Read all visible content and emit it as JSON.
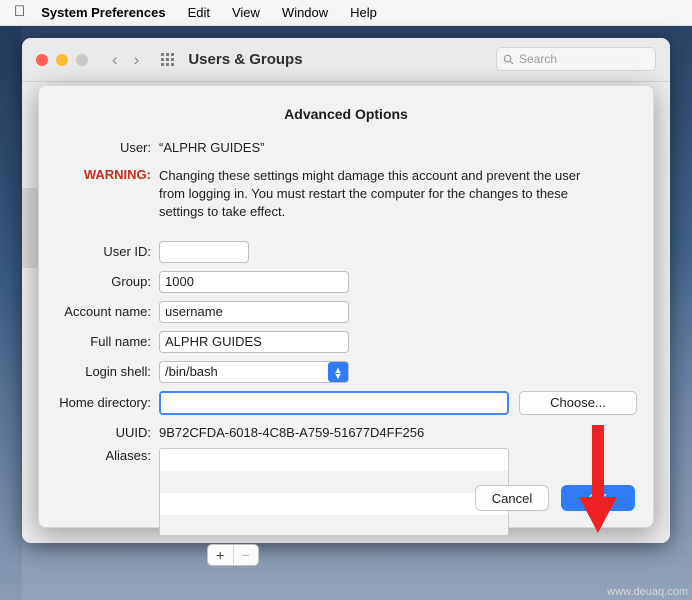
{
  "menubar": {
    "apple_icon": "apple-icon",
    "items": [
      {
        "label": "System Preferences",
        "bold": true
      },
      {
        "label": "Edit",
        "bold": false
      },
      {
        "label": "View",
        "bold": false
      },
      {
        "label": "Window",
        "bold": false
      },
      {
        "label": "Help",
        "bold": false
      }
    ]
  },
  "prefs_window": {
    "title": "Users & Groups",
    "search_placeholder": "Search",
    "back_icon": "chevron-left-icon",
    "forward_icon": "chevron-right-icon",
    "grid_icon": "grid-icon",
    "search_icon": "search-icon"
  },
  "sheet": {
    "title": "Advanced Options",
    "user_label": "User:",
    "user_value": "“ALPHR GUIDES”",
    "warning_label": "WARNING:",
    "warning_text": "Changing these settings might damage this account and prevent the user from logging in. You must restart the computer for the changes to these settings to take effect.",
    "fields": {
      "user_id": {
        "label": "User ID:",
        "value": ""
      },
      "group": {
        "label": "Group:",
        "value": "1000"
      },
      "account_name": {
        "label": "Account name:",
        "value": "username"
      },
      "full_name": {
        "label": "Full name:",
        "value": "ALPHR GUIDES"
      },
      "login_shell": {
        "label": "Login shell:",
        "value": "/bin/bash",
        "dropdown_icon": "chevron-updown-icon"
      },
      "home_directory": {
        "label": "Home directory:",
        "value": "",
        "choose_label": "Choose..."
      },
      "uuid": {
        "label": "UUID:",
        "value": "9B72CFDA-6018-4C8B-A759-51677D4FF256"
      },
      "aliases": {
        "label": "Aliases:",
        "value": ""
      }
    },
    "alias_add_label": "+",
    "alias_remove_label": "−",
    "cancel_label": "Cancel",
    "ok_label": "OK"
  },
  "annotation": {
    "arrow_icon": "red-down-arrow-icon",
    "arrow_color": "#ee2222"
  },
  "watermark": "www.deuaq.com"
}
